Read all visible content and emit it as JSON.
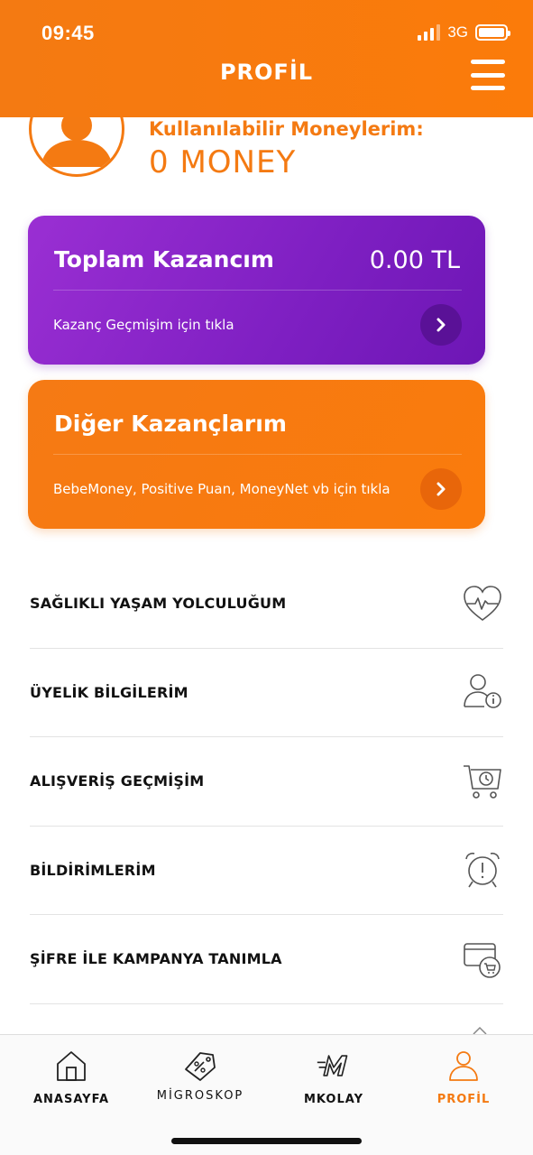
{
  "status_bar": {
    "time": "09:45",
    "network": "3G"
  },
  "header": {
    "title": "PROFİL"
  },
  "profile": {
    "money_label": "Kullanılabilir Moneylerim:",
    "money_value": "0 MONEY"
  },
  "cards": [
    {
      "title": "Toplam Kazancım",
      "amount": "0.00 TL",
      "link": "Kazanç Geçmişim için tıkla"
    },
    {
      "title": "Diğer Kazançlarım",
      "link": "BebeMoney, Positive Puan, MoneyNet vb için tıkla"
    }
  ],
  "menu": [
    {
      "label": "SAĞLIKLI YAŞAM YOLCULUĞUM",
      "icon": "heart-pulse-icon"
    },
    {
      "label": "ÜYELİK BİLGİLERİM",
      "icon": "user-info-icon"
    },
    {
      "label": "ALIŞVERİŞ GEÇMİŞİM",
      "icon": "cart-clock-icon"
    },
    {
      "label": "BİLDİRİMLERİM",
      "icon": "alarm-clock-icon"
    },
    {
      "label": "ŞİFRE İLE KAMPANYA TANIMLA",
      "icon": "card-cart-icon"
    }
  ],
  "tabs": [
    {
      "label": "ANASAYFA",
      "icon": "home-icon"
    },
    {
      "label": "MİGROSKOP",
      "icon": "price-tag-icon"
    },
    {
      "label": "MKOLAY",
      "icon": "mkolay-icon"
    },
    {
      "label": "PROFİL",
      "icon": "user-icon",
      "active": true
    }
  ],
  "colors": {
    "accent": "#f47a12",
    "purple": "#8a25c9",
    "text": "#111111"
  }
}
